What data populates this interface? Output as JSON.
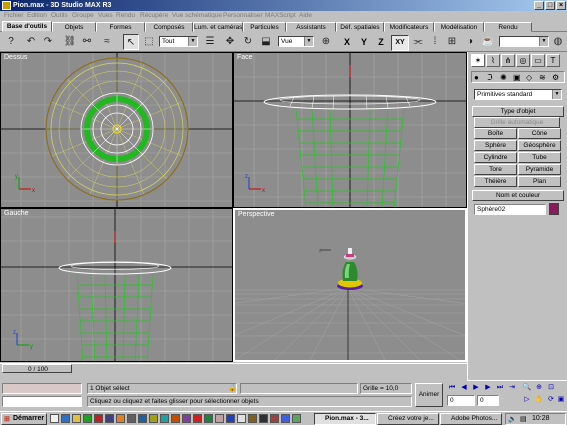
{
  "window": {
    "title": "Pion.max - 3D Studio MAX R3"
  },
  "menu": [
    "Fichier",
    "Edition",
    "Outils",
    "Groupe",
    "Vues",
    "Rendu",
    "Récupére",
    "Vue schématique",
    "Personnaliser",
    "MAXScript",
    "Aide"
  ],
  "tabs": [
    "Base d'outils",
    "Objets",
    "Formes",
    "Composés",
    "Lum. et caméras",
    "Particules",
    "Assistants",
    "Déf. spatiales",
    "Modificateurs",
    "Modélisation",
    "Rendu"
  ],
  "toolbar": {
    "selection_filter": "Tout",
    "coord_system": "Vue",
    "axes": [
      "X",
      "Y",
      "Z",
      "XY"
    ],
    "named_selection": ""
  },
  "viewports": {
    "top": "Dessus",
    "front": "Face",
    "left": "Gauche",
    "perspective": "Perspective"
  },
  "command_panel": {
    "category_dropdown": "Primitives standard",
    "object_type_header": "Type d'objet",
    "autogrid_label": "Grille automatique",
    "object_buttons": [
      "Boîte",
      "Cône",
      "Sphère",
      "Géosphère",
      "Cylindre",
      "Tube",
      "Tore",
      "Pyramide",
      "Théière",
      "Plan"
    ],
    "name_color_header": "Nom et couleur",
    "object_name": "Sphère02",
    "object_color": "#8b1a5a"
  },
  "status": {
    "time_slider": "0 / 100",
    "selection_info": "1 Objet sélect",
    "prompt": "Cliquez ou cliquez et faites glisser pour sélectionner objets",
    "grid": "Grille = 10,0",
    "animate_label": "Animer",
    "frame": "0",
    "spinner_value": "0"
  },
  "taskbar": {
    "start_label": "Démarrer",
    "tasks": [
      "Pion.max - 3...",
      "Créez votre je...",
      "Adobe Photos..."
    ],
    "clock": "10:28"
  }
}
